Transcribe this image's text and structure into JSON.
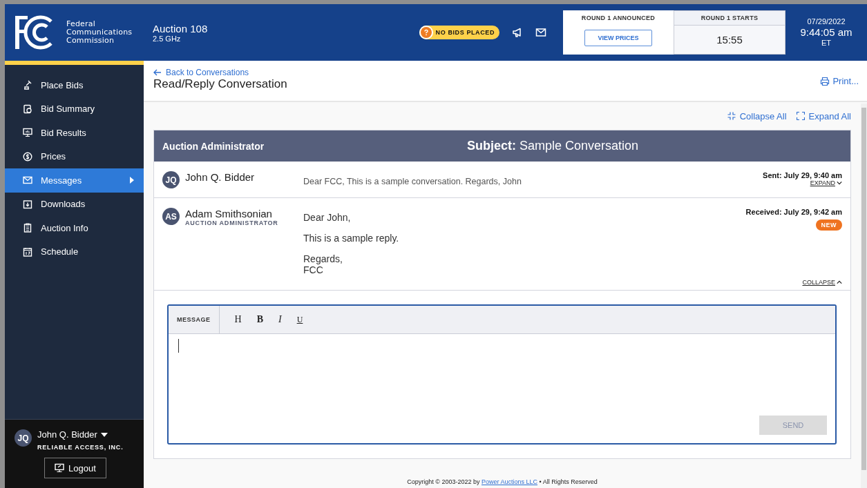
{
  "header": {
    "org_name": [
      "Federal",
      "Communications",
      "Commission"
    ],
    "auction_title": "Auction 108",
    "auction_band": "2.5 GHz",
    "bid_status": "NO BIDS PLACED",
    "round_announced": {
      "label": "ROUND 1 ANNOUNCED",
      "button": "VIEW PRICES"
    },
    "round_starts": {
      "label": "ROUND 1 STARTS",
      "countdown": "15:55"
    },
    "clock": {
      "date": "07/29/2022",
      "time": "9:44:05 am",
      "zone": "ET"
    }
  },
  "sidebar": {
    "items": [
      {
        "label": "Place Bids",
        "selected": false
      },
      {
        "label": "Bid Summary",
        "selected": false
      },
      {
        "label": "Bid Results",
        "selected": false
      },
      {
        "label": "Prices",
        "selected": false
      },
      {
        "label": "Messages",
        "selected": true
      },
      {
        "label": "Downloads",
        "selected": false
      },
      {
        "label": "Auction Info",
        "selected": false
      },
      {
        "label": "Schedule",
        "selected": false
      }
    ],
    "user": {
      "initials": "JQ",
      "name": "John Q. Bidder",
      "company": "RELIABLE ACCESS, INC.",
      "logout": "Logout"
    }
  },
  "page": {
    "back_link": "Back to Conversations",
    "title": "Read/Reply Conversation",
    "print": "Print...",
    "collapse_all": "Collapse All",
    "expand_all": "Expand All"
  },
  "conversation": {
    "party": "Auction Administrator",
    "subject_label": "Subject:",
    "subject": "Sample Conversation",
    "messages": [
      {
        "initials": "JQ",
        "sender": "John Q. Bidder",
        "expanded": false,
        "new": false,
        "preview": "Dear FCC, This is a sample conversation. Regards, John",
        "timestamp": "Sent: July 29, 9:40 am",
        "toggle": "EXPAND"
      },
      {
        "initials": "AS",
        "sender": "Adam Smithsonian",
        "role": "AUCTION ADMINISTRATOR",
        "expanded": true,
        "new": true,
        "badge": "NEW",
        "paragraphs": [
          [
            "Dear John,"
          ],
          [
            "This is a sample reply."
          ],
          [
            "Regards,",
            "FCC"
          ]
        ],
        "timestamp": "Received: July 29, 9:42 am",
        "toggle": "COLLAPSE"
      }
    ]
  },
  "reply": {
    "label": "MESSAGE",
    "tools": [
      {
        "kind": "heading",
        "label": "H"
      },
      {
        "kind": "bold",
        "label": "B"
      },
      {
        "kind": "italic",
        "label": "I"
      },
      {
        "kind": "underline",
        "label": "U"
      }
    ],
    "send": "SEND",
    "send_disabled": true
  },
  "footer": {
    "prefix": "Copyright © 2003-2022 by ",
    "link": "Power Auctions LLC",
    "suffix": " • All Rights Reserved"
  }
}
